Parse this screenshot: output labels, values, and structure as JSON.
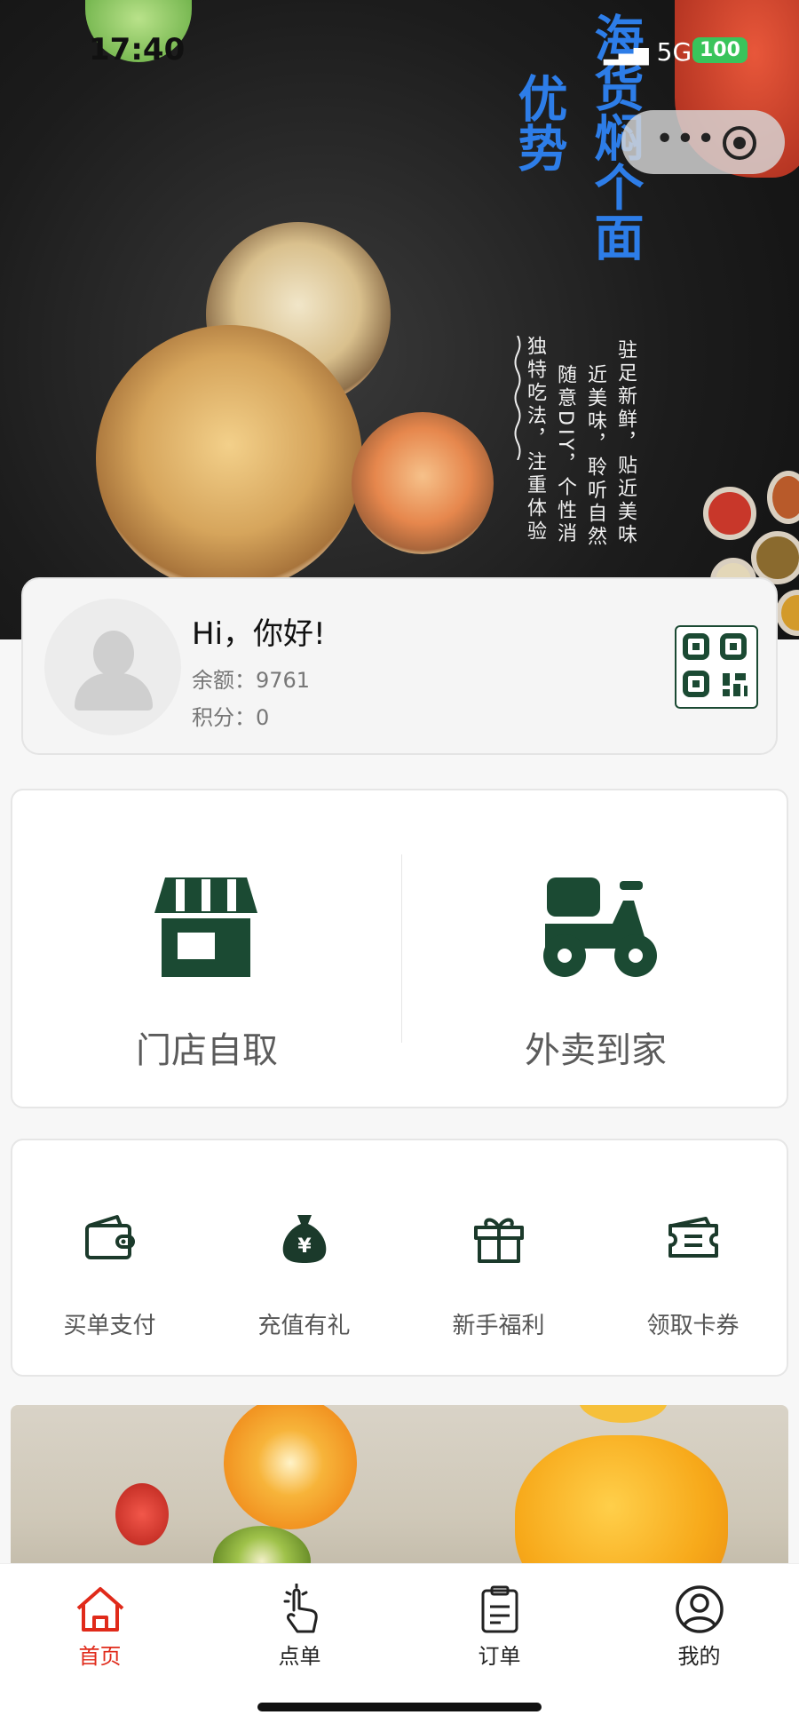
{
  "status_bar": {
    "time": "17:40",
    "network": "5G",
    "battery": "100"
  },
  "hero": {
    "title_big": "优势",
    "title_side": "海货焖个面",
    "description_lines": [
      "驻足新鲜，贴近美味",
      "近美味，聆听自然",
      "随意DIY，个性消",
      "独特吃法，注重体验"
    ]
  },
  "profile": {
    "greeting": "Hi，你好!",
    "balance_label": "余额：",
    "balance_value": "9761",
    "points_label": "积分：",
    "points_value": "0"
  },
  "order_modes": [
    {
      "label": "门店自取",
      "icon": "storefront-icon"
    },
    {
      "label": "外卖到家",
      "icon": "scooter-icon"
    }
  ],
  "services": [
    {
      "label": "买单支付",
      "icon": "wallet-icon"
    },
    {
      "label": "充值有礼",
      "icon": "money-bag-icon"
    },
    {
      "label": "新手福利",
      "icon": "gift-icon"
    },
    {
      "label": "领取卡券",
      "icon": "ticket-icon"
    }
  ],
  "tabs": [
    {
      "label": "首页",
      "icon": "home-icon",
      "active": true
    },
    {
      "label": "点单",
      "icon": "tap-icon",
      "active": false
    },
    {
      "label": "订单",
      "icon": "clipboard-icon",
      "active": false
    },
    {
      "label": "我的",
      "icon": "user-icon",
      "active": false
    }
  ],
  "colors": {
    "brand_green": "#1b4a33",
    "accent_red": "#e02a1a",
    "title_blue": "#2d7de8"
  }
}
